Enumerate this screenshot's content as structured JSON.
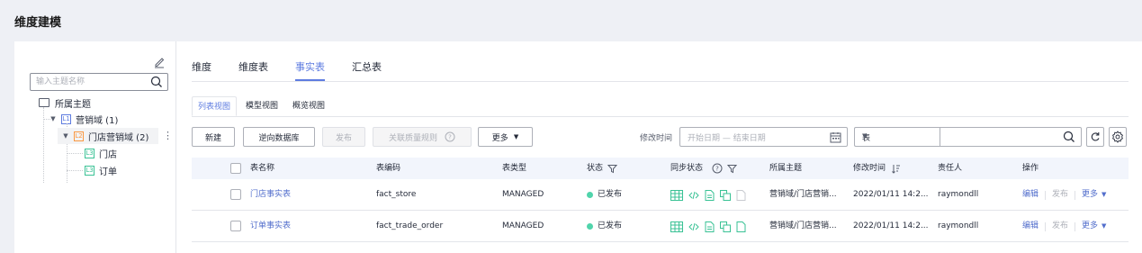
{
  "page_title": "维度建模",
  "tree": {
    "search_placeholder": "输入主题名称",
    "root_label": "所属主题",
    "nodes": [
      {
        "label": "营销域 (1)",
        "icon_text": "L1"
      },
      {
        "label": "门店营销域 (2)",
        "icon_text": "L2"
      },
      {
        "label": "门店",
        "icon_text": "L3"
      },
      {
        "label": "订单",
        "icon_text": "L3"
      }
    ]
  },
  "tabs": [
    "维度",
    "维度表",
    "事实表",
    "汇总表"
  ],
  "active_tab": "事实表",
  "views": [
    "列表视图",
    "模型视图",
    "概览视图"
  ],
  "toolbar": {
    "new_label": "新建",
    "reverse_label": "逆向数据库",
    "publish_label": "发布",
    "quality_label": "关联质量规则",
    "more_label": "更多",
    "modified_time_label": "修改时间",
    "date_placeholder": "开始日期 — 结束日期",
    "table_select": "表"
  },
  "table": {
    "headers": [
      "表名称",
      "表编码",
      "表类型",
      "状态",
      "同步状态",
      "所属主题",
      "修改时间",
      "责任人",
      "操作"
    ],
    "rows": [
      {
        "name": "门店事实表",
        "code": "fact_store",
        "type": "MANAGED",
        "status": "已发布",
        "subject": "营销域/门店营销...",
        "modified": "2022/01/11 14:2...",
        "owner": "raymondll"
      },
      {
        "name": "订单事实表",
        "code": "fact_trade_order",
        "type": "MANAGED",
        "status": "已发布",
        "subject": "营销域/门店营销...",
        "modified": "2022/01/11 14:2...",
        "owner": "raymondll"
      }
    ],
    "ops": {
      "edit": "编辑",
      "publish": "发布",
      "more": "更多"
    }
  },
  "colors": {
    "accent": "#5e7ce0",
    "link": "#526ecc",
    "published": "#50d4ab",
    "sync": "#3ac295"
  }
}
